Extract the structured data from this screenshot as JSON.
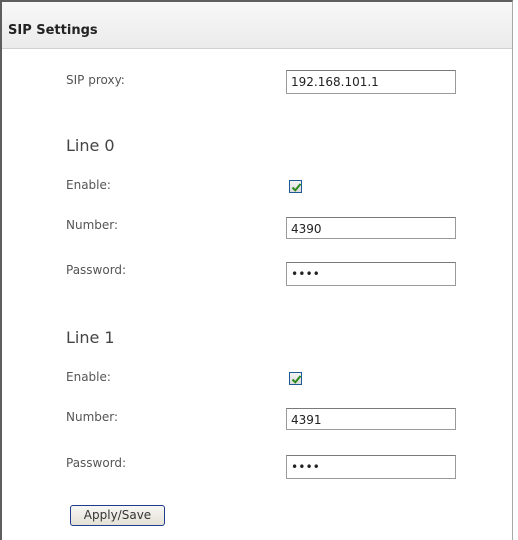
{
  "panel": {
    "title": "SIP Settings"
  },
  "sip_proxy": {
    "label": "SIP proxy:",
    "value": "192.168.101.1"
  },
  "lines": [
    {
      "heading": "Line 0",
      "enable_label": "Enable:",
      "enabled": true,
      "number_label": "Number:",
      "number_value": "4390",
      "password_label": "Password:",
      "password_value": "••••"
    },
    {
      "heading": "Line 1",
      "enable_label": "Enable:",
      "enabled": true,
      "number_label": "Number:",
      "number_value": "4391",
      "password_label": "Password:",
      "password_value": "••••"
    }
  ],
  "apply_button": {
    "label": "Apply/Save"
  },
  "colors": {
    "checkmark": "#2a8a1e",
    "button_border": "#1f3d8a"
  }
}
